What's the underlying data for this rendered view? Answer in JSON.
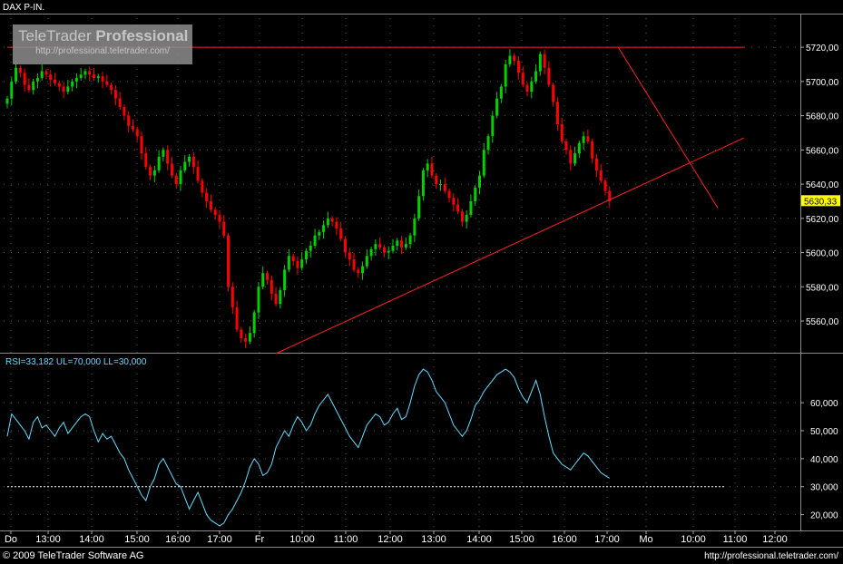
{
  "instrument": "DAX P-IN.",
  "watermark": {
    "brand_a": "TeleTrader",
    "brand_b": "Professional",
    "url": "http://professional.teletrader.com/"
  },
  "indicator_label": "RSI=33,182 UL=70,000 LL=30,000",
  "copyright": "© 2009 TeleTrader Software AG",
  "footer_url": "http://professional.teletrader.com/",
  "colors": {
    "up": "#00d000",
    "down": "#ff0000",
    "rsi": "#66ddff",
    "trend": "#ff2020",
    "grid": "#555555",
    "axis_text": "#ffffff",
    "last_price_bg": "#ffff00"
  },
  "chart_data": [
    {
      "type": "candlestick",
      "title": "DAX P-IN.",
      "price_ticks": [
        "5560,00",
        "5580,00",
        "5600,00",
        "5620,00",
        "5640,00",
        "5660,00",
        "5680,00",
        "5700,00",
        "5720,00"
      ],
      "ylim": [
        5542,
        5737
      ],
      "last_price_label": "5630,33",
      "last_price": 5630.33,
      "time_labels": [
        "Do",
        "13:00",
        "14:00",
        "15:00",
        "16:00",
        "17:00",
        "Fr",
        "10:00",
        "11:00",
        "12:00",
        "13:00",
        "14:00",
        "15:00",
        "16:00",
        "17:00",
        "Mo",
        "10:00",
        "11:00",
        "12:00"
      ],
      "closes": [
        5690,
        5700,
        5708,
        5705,
        5698,
        5695,
        5700,
        5702,
        5706,
        5704,
        5701,
        5699,
        5697,
        5694,
        5697,
        5700,
        5702,
        5704,
        5706,
        5704,
        5702,
        5703,
        5700,
        5698,
        5695,
        5690,
        5685,
        5680,
        5674,
        5672,
        5668,
        5658,
        5650,
        5645,
        5648,
        5656,
        5660,
        5652,
        5645,
        5640,
        5648,
        5653,
        5656,
        5650,
        5642,
        5635,
        5630,
        5625,
        5622,
        5618,
        5610,
        5580,
        5568,
        5555,
        5550,
        5548,
        5553,
        5565,
        5580,
        5588,
        5584,
        5576,
        5570,
        5578,
        5590,
        5598,
        5595,
        5591,
        5596,
        5601,
        5604,
        5610,
        5612,
        5616,
        5620,
        5618,
        5614,
        5608,
        5600,
        5596,
        5590,
        5588,
        5592,
        5598,
        5602,
        5605,
        5603,
        5600,
        5601,
        5604,
        5607,
        5603,
        5605,
        5610,
        5620,
        5633,
        5648,
        5652,
        5645,
        5640,
        5640,
        5636,
        5632,
        5628,
        5624,
        5618,
        5622,
        5630,
        5638,
        5645,
        5660,
        5668,
        5680,
        5690,
        5697,
        5710,
        5715,
        5712,
        5705,
        5698,
        5694,
        5700,
        5706,
        5716,
        5708,
        5698,
        5688,
        5675,
        5665,
        5660,
        5652,
        5658,
        5664,
        5668,
        5665,
        5655,
        5648,
        5642,
        5636,
        5630
      ],
      "trendlines": [
        {
          "name": "resistance",
          "from": [
            0,
            5720
          ],
          "to": [
            170,
            5720
          ]
        },
        {
          "name": "rising-support",
          "from": [
            62,
            5541
          ],
          "to": [
            170,
            5667
          ]
        },
        {
          "name": "falling-line",
          "from": [
            141,
            5720
          ],
          "to": [
            164,
            5626
          ]
        }
      ]
    },
    {
      "type": "line",
      "title": "RSI",
      "ticks": [
        "20,000",
        "30,000",
        "40,000",
        "50,000",
        "60,000"
      ],
      "ylim": [
        15,
        73
      ],
      "upper_limit": 70,
      "lower_limit": 30,
      "values": [
        48,
        56,
        54,
        52,
        50,
        47,
        53,
        55,
        51,
        52,
        50,
        48,
        51,
        53,
        49,
        51,
        53,
        55,
        56,
        55,
        50,
        46,
        49,
        47,
        48,
        45,
        42,
        40,
        36,
        33,
        30,
        27,
        25,
        30,
        33,
        38,
        40,
        37,
        34,
        31,
        30,
        26,
        22,
        25,
        28,
        24,
        20,
        18,
        17,
        16,
        17,
        20,
        22,
        25,
        28,
        32,
        37,
        40,
        38,
        34,
        35,
        38,
        44,
        47,
        50,
        48,
        52,
        55,
        53,
        50,
        52,
        56,
        59,
        61,
        63,
        60,
        57,
        54,
        51,
        48,
        46,
        44,
        48,
        52,
        54,
        56,
        55,
        52,
        53,
        56,
        58,
        54,
        55,
        60,
        66,
        70,
        72,
        71,
        68,
        64,
        62,
        60,
        56,
        52,
        50,
        48,
        50,
        54,
        59,
        61,
        64,
        66,
        68,
        70,
        71,
        72,
        71,
        69,
        65,
        62,
        60,
        64,
        68,
        63,
        55,
        48,
        42,
        40,
        38,
        37,
        36,
        38,
        40,
        42,
        41,
        39,
        37,
        35,
        34,
        33
      ]
    }
  ]
}
